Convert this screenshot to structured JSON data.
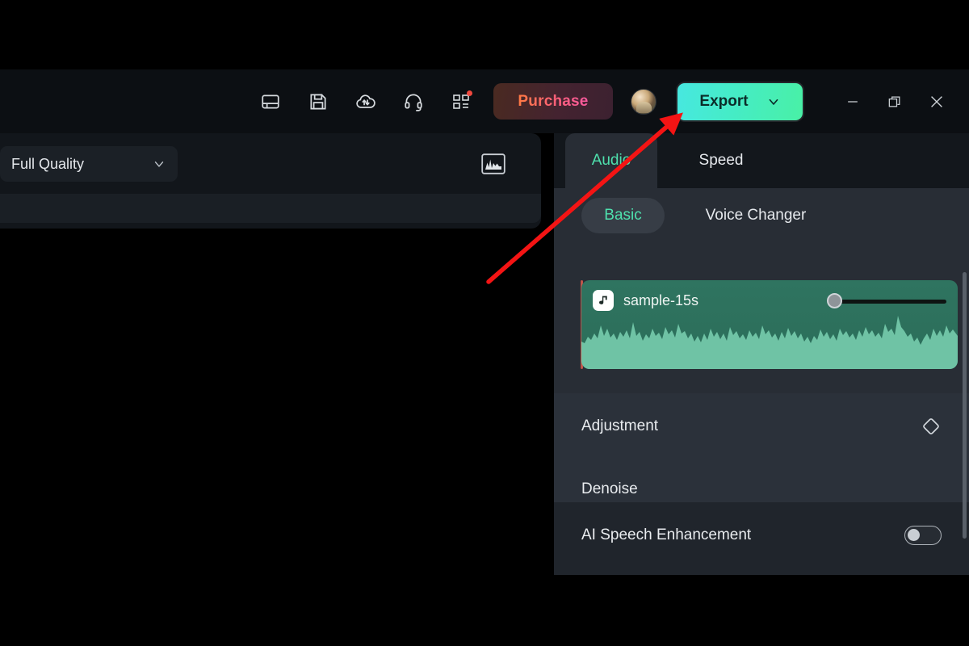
{
  "toolbar": {
    "icons": [
      {
        "name": "layout-panel-icon",
        "label": "Layout"
      },
      {
        "name": "save-icon",
        "label": "Save"
      },
      {
        "name": "cloud-transfer-icon",
        "label": "Cloud Backup"
      },
      {
        "name": "headset-support-icon",
        "label": "Support"
      },
      {
        "name": "grid-apps-icon",
        "label": "More",
        "badge": true
      }
    ],
    "purchase_label": "Purchase",
    "export_label": "Export",
    "export_chevron_icon": "chevron-down-icon",
    "avatar_name": "user-avatar",
    "minimize_icon": "minimize-icon",
    "restore_icon": "restore-icon",
    "close_icon": "close-icon",
    "accent_export_start": "#47e8e0",
    "accent_export_end": "#49f0a6",
    "purchase_text_start": "#ff7a42",
    "purchase_text_end": "#f85aa0",
    "badge_color": "#f0483e"
  },
  "preview": {
    "quality_label": "Full Quality",
    "quality_chevron_icon": "chevron-down-icon",
    "waveform_button_icon": "audio-histogram-icon"
  },
  "right_panel": {
    "tabs": [
      {
        "label": "Audio",
        "active": true
      },
      {
        "label": "Speed",
        "active": false
      }
    ],
    "subtabs": [
      {
        "label": "Basic",
        "active": true
      },
      {
        "label": "Voice Changer",
        "active": false
      }
    ],
    "clip": {
      "name": "sample-15s",
      "icon": "music-note-icon",
      "volume_percent": 0,
      "waveform_color": "#6fc3a5",
      "card_color": "#2f7460"
    },
    "settings": [
      {
        "label": "Adjustment",
        "control": "keyframe-diamond-icon"
      },
      {
        "label": "Denoise",
        "control": "none"
      },
      {
        "label": "AI Speech Enhancement",
        "control": "toggle",
        "value": "off"
      }
    ]
  },
  "annotation": {
    "arrow_color": "#f41414",
    "arrow_from": "605,348",
    "arrow_to": "840,145",
    "points_at": "Export"
  }
}
